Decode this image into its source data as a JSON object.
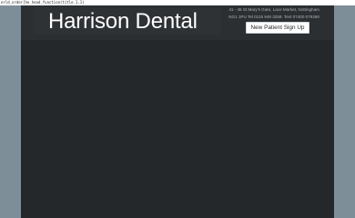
{
  "debug": {
    "text": "orld_order[he_head_function(title_1,1)"
  },
  "header": {
    "title": "Harrison Dental",
    "address_line_1": "41 - 45 St Mary's Gate, Lace Market, Nottingham",
    "address_line_2": "NG1 1PU Tel 0115 948 3259. Text 07400 079290"
  },
  "actions": {
    "signup_label": "New Patient Sign Up"
  },
  "colors": {
    "page_background": "#7d8c97",
    "panel_background": "#24282b",
    "button_background": "#ffffff",
    "title_text": "#ffffff"
  }
}
